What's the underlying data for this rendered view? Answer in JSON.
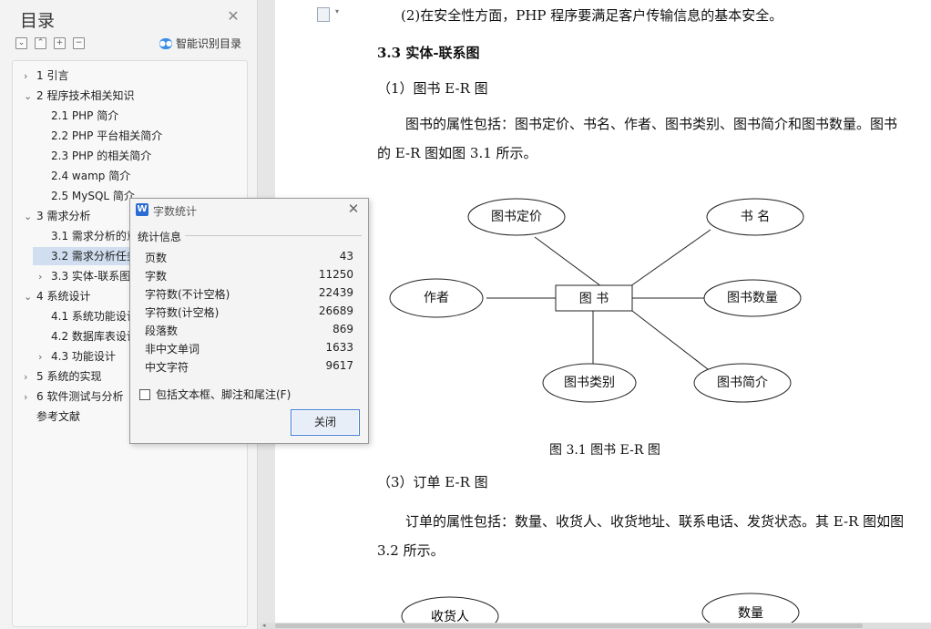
{
  "nav": {
    "title": "目录",
    "smart_label": "智能识别目录",
    "items": [
      {
        "label": "1   引言",
        "arrow": "›"
      },
      {
        "label": "2  程序技术相关知识",
        "arrow": "⌄"
      },
      {
        "label": "2.1 PHP 简介",
        "arrow": ""
      },
      {
        "label": "2.2 PHP  平台相关简介",
        "arrow": ""
      },
      {
        "label": "2.3 PHP 的相关简介",
        "arrow": ""
      },
      {
        "label": "2.4 wamp 简介",
        "arrow": ""
      },
      {
        "label": "2.5 MySQL 简介",
        "arrow": ""
      },
      {
        "label": "3    需求分析",
        "arrow": "⌄"
      },
      {
        "label": "3.1  需求分析的意义",
        "arrow": ""
      },
      {
        "label": "3.2 需求分析任务",
        "arrow": ""
      },
      {
        "label": "3.3 实体-联系图",
        "arrow": "›"
      },
      {
        "label": "4    系统设计",
        "arrow": "⌄"
      },
      {
        "label": "4.1  系统功能设计",
        "arrow": ""
      },
      {
        "label": "4.2 数据库表设计",
        "arrow": ""
      },
      {
        "label": "4.3    功能设计",
        "arrow": "›"
      },
      {
        "label": "5 系统的实现",
        "arrow": "›"
      },
      {
        "label": "6    软件测试与分析",
        "arrow": "›"
      },
      {
        "label": "参考文献",
        "arrow": ""
      }
    ]
  },
  "doc": {
    "line1": "(2)在安全性方面，PHP 程序要满足客户传输信息的基本安全。",
    "heading": "3.3 实体-联系图",
    "sub1": "（1）图书 E-R 图",
    "para1a": "图书的属性包括：图书定价、书名、作者、图书类别、图书简介和图书数量。图书",
    "para1b": "的 E-R 图如图 3.1 所示。",
    "er": {
      "center": "图 书",
      "price": "图书定价",
      "name": "书 名",
      "author": "作者",
      "quantity": "图书数量",
      "category": "图书类别",
      "intro": "图书简介"
    },
    "caption": "图 3.1   图书 E-R 图",
    "sub3": "（3）订单 E-R 图",
    "para3a": "订单的属性包括：数量、收货人、收货地址、联系电话、发货状态。其 E-R 图如图",
    "para3b": "3.2 所示。",
    "er2_receiver": "收货人",
    "er2_quantity": "数量"
  },
  "dialog": {
    "title": "字数统计",
    "section": "统计信息",
    "stats": [
      {
        "label": "页数",
        "value": "43"
      },
      {
        "label": "字数",
        "value": "11250"
      },
      {
        "label": "字符数(不计空格)",
        "value": "22439"
      },
      {
        "label": "字符数(计空格)",
        "value": "26689"
      },
      {
        "label": "段落数",
        "value": "869"
      },
      {
        "label": "非中文单词",
        "value": "1633"
      },
      {
        "label": "中文字符",
        "value": "9617"
      }
    ],
    "checkbox_label": "包括文本框、脚注和尾注(F)",
    "close_label": "关闭"
  }
}
